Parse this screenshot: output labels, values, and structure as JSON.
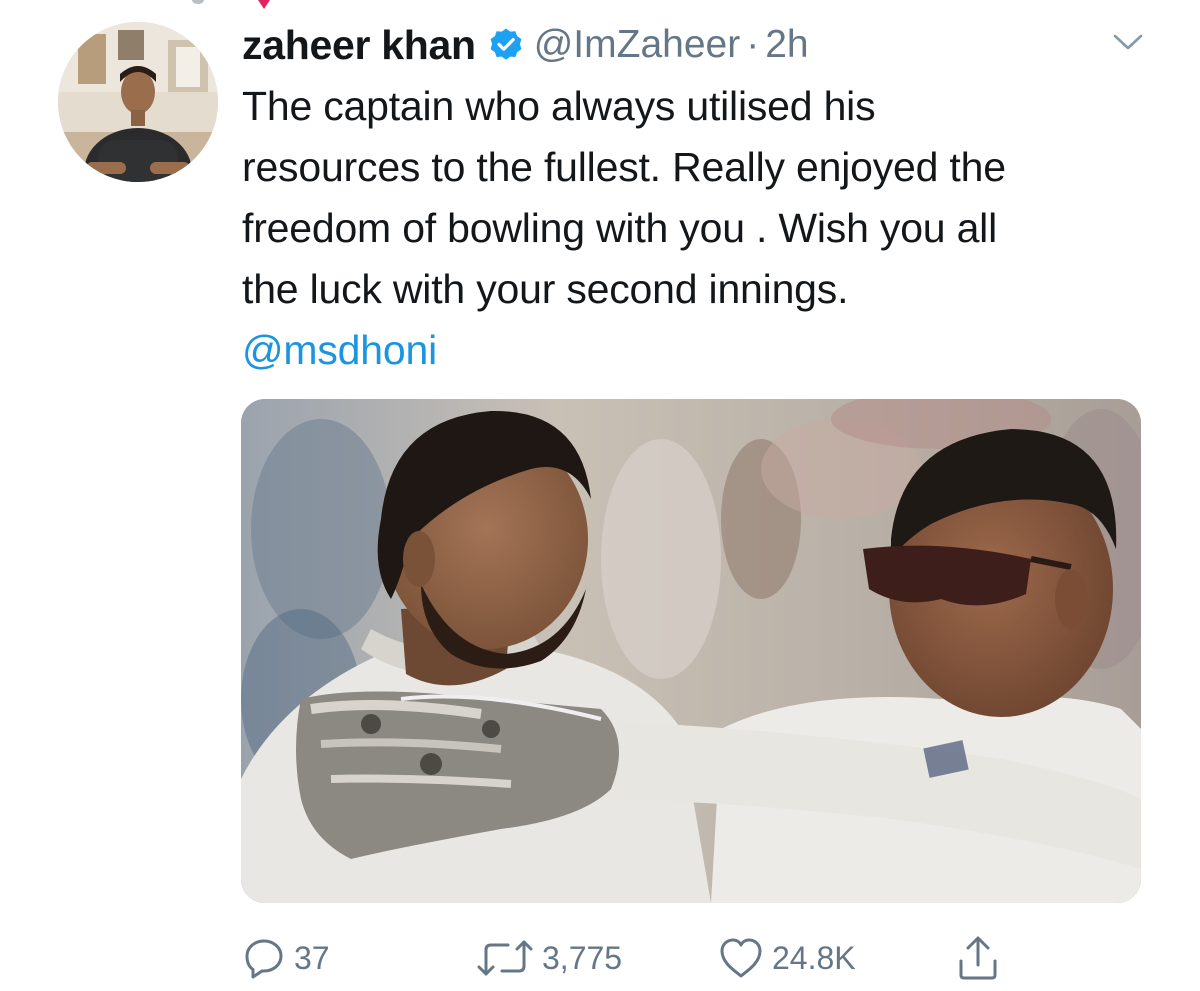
{
  "tweet": {
    "author": {
      "display_name": "zaheer khan",
      "handle": "@ImZaheer",
      "verified": true,
      "verified_icon": "verified-badge-icon"
    },
    "separator": "·",
    "time": "2h",
    "text_lines": [
      "The captain who always utilised his",
      "resources to the fullest. Really enjoyed the",
      "freedom of bowling with you . Wish you all",
      "the luck with your second innings."
    ],
    "mention": "@msdhoni",
    "actions": {
      "reply": {
        "icon": "reply-icon",
        "count": "37"
      },
      "retweet": {
        "icon": "retweet-icon",
        "count": "3,775"
      },
      "like": {
        "icon": "heart-icon",
        "count": "24.8K"
      },
      "share": {
        "icon": "share-icon"
      }
    }
  },
  "colors": {
    "text": "#14171a",
    "secondary": "#657786",
    "link": "#1b95e0",
    "verified": "#1da1f2"
  }
}
